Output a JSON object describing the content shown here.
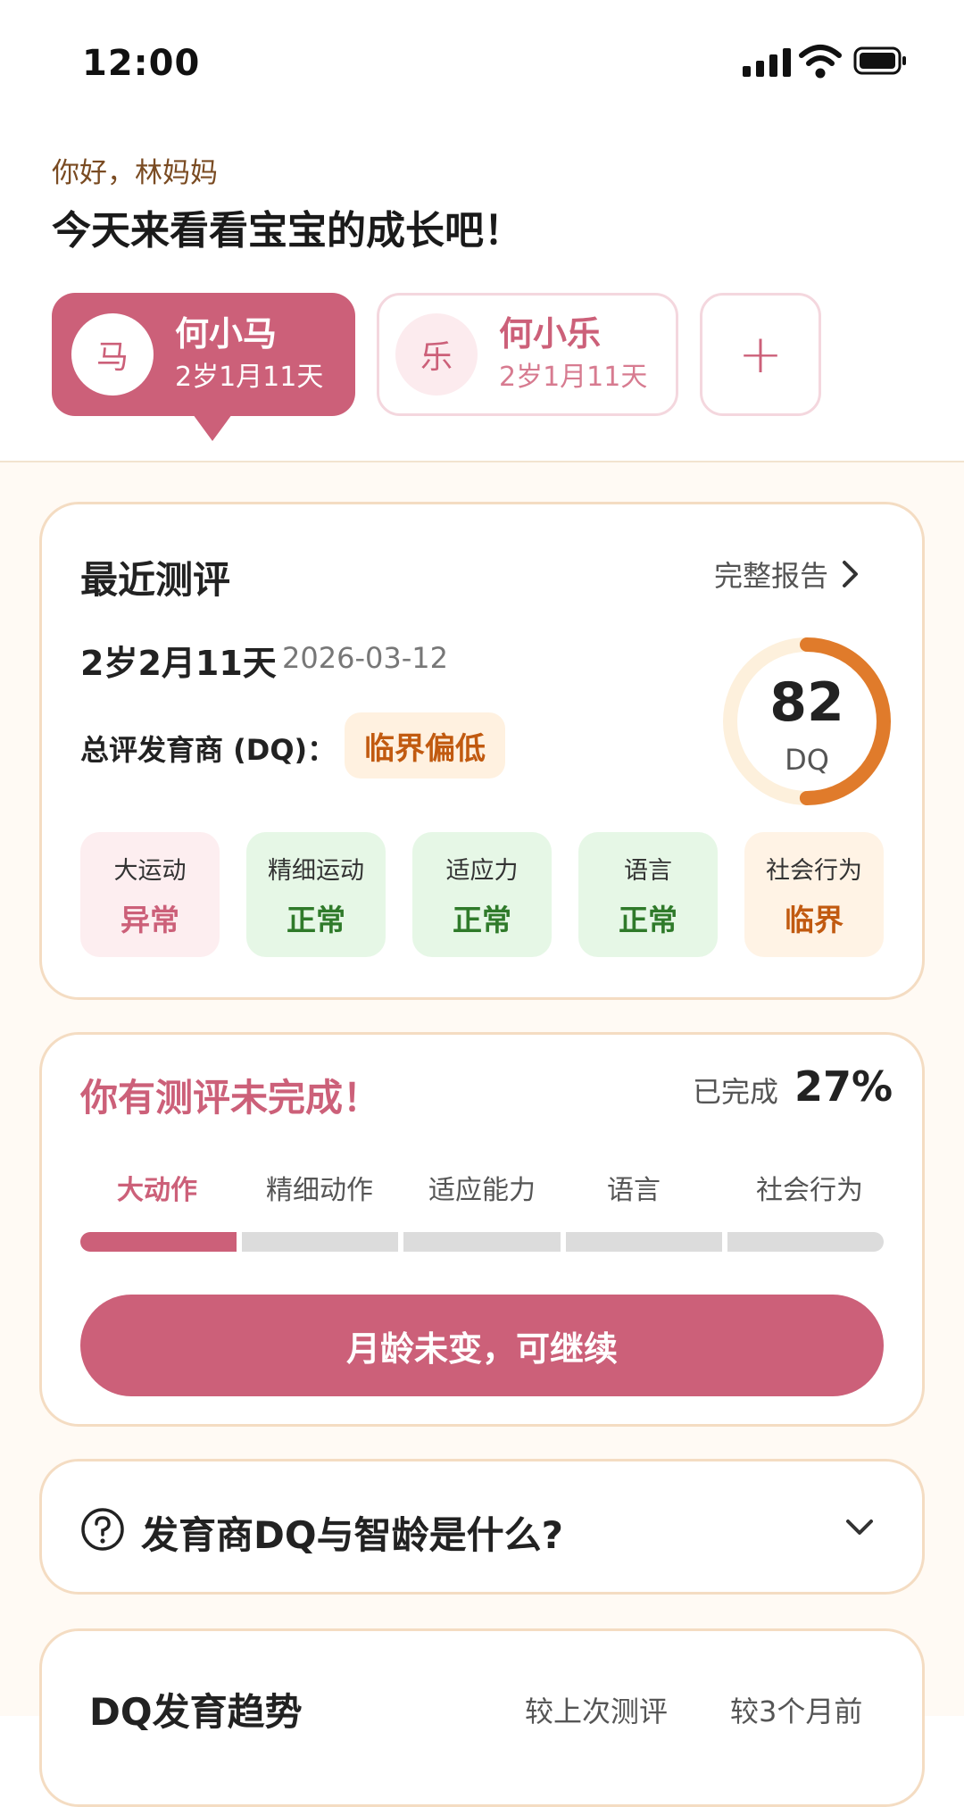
{
  "status_bar": {
    "time": "12:00"
  },
  "greeting": {
    "hello": "你好，林妈妈",
    "headline": "今天来看看宝宝的成长吧！"
  },
  "children": [
    {
      "avatar": "马",
      "name": "何小马",
      "age": "2岁1月11天",
      "selected": true
    },
    {
      "avatar": "乐",
      "name": "何小乐",
      "age": "2岁1月11天",
      "selected": false
    }
  ],
  "add_child": {
    "label": "+"
  },
  "recent": {
    "title": "最近测评",
    "report_link": "完整报告",
    "age": "2岁2月11天",
    "date": "2026-03-12",
    "dq_label": "总评发育商 (DQ)：",
    "dq_level": "临界偏低",
    "dq_value": "82",
    "dq_unit": "DQ",
    "dq_score": 82,
    "domains": [
      {
        "label": "大运动",
        "status": "异常",
        "kind": "abnormal"
      },
      {
        "label": "精细运动",
        "status": "正常",
        "kind": "normal"
      },
      {
        "label": "适应力",
        "status": "正常",
        "kind": "normal"
      },
      {
        "label": "语言",
        "status": "正常",
        "kind": "normal"
      },
      {
        "label": "社会行为",
        "status": "临界",
        "kind": "borderline"
      }
    ],
    "colors": {
      "abnormal": "#cc6079",
      "normal": "#2f7a2a",
      "borderline": "#c15a10"
    }
  },
  "incomplete": {
    "title": "你有测评未完成！",
    "done_label": "已完成",
    "percent": "27%",
    "steps": [
      "大动作",
      "精细动作",
      "适应能力",
      "语言",
      "社会行为"
    ],
    "steps_completed": 1,
    "button": "月龄未变，可继续"
  },
  "faq": {
    "question": "发育商DQ与智龄是什么?",
    "icon": "question-circle-icon"
  },
  "trend": {
    "title": "DQ发育趋势",
    "option1": "较上次测评",
    "option2": "较3个月前"
  },
  "theme": {
    "accent": "#cc6079",
    "warning": "#c15a10",
    "gauge": "#e07b2b",
    "gauge_track": "#fdf0dc"
  }
}
